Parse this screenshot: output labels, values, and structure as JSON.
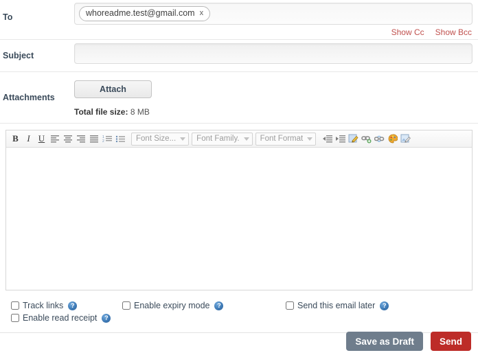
{
  "form": {
    "to": {
      "label": "To",
      "recipients": [
        {
          "address": "whoreadme.test@gmail.com",
          "remove_label": "x"
        }
      ],
      "show_cc": "Show Cc",
      "show_bcc": "Show Bcc"
    },
    "subject": {
      "label": "Subject",
      "value": "",
      "placeholder": ""
    },
    "attachments": {
      "label": "Attachments",
      "attach_button": "Attach",
      "total_size_label": "Total file size:",
      "total_size_value": "8 MB"
    }
  },
  "editor": {
    "toolbar": {
      "buttons": [
        {
          "name": "bold-icon",
          "glyph": "B"
        },
        {
          "name": "italic-icon",
          "glyph": "I"
        },
        {
          "name": "underline-icon",
          "glyph": "U"
        },
        {
          "name": "align-left-icon",
          "glyph": ""
        },
        {
          "name": "align-center-icon",
          "glyph": ""
        },
        {
          "name": "align-right-icon",
          "glyph": ""
        },
        {
          "name": "align-justify-icon",
          "glyph": ""
        },
        {
          "name": "ordered-list-icon",
          "glyph": ""
        },
        {
          "name": "unordered-list-icon",
          "glyph": ""
        },
        {
          "name": "outdent-icon",
          "glyph": ""
        },
        {
          "name": "indent-icon",
          "glyph": ""
        },
        {
          "name": "edit-source-icon",
          "glyph": ""
        },
        {
          "name": "insert-link-icon",
          "glyph": ""
        },
        {
          "name": "unlink-icon",
          "glyph": ""
        },
        {
          "name": "text-color-icon",
          "glyph": ""
        },
        {
          "name": "insert-image-icon",
          "glyph": ""
        }
      ],
      "selects": [
        {
          "name": "font-size-select",
          "label": "Font Size..."
        },
        {
          "name": "font-family-select",
          "label": "Font Family."
        },
        {
          "name": "font-format-select",
          "label": "Font Format"
        }
      ]
    },
    "body": ""
  },
  "options": [
    {
      "id": "track-links",
      "label": "Track links",
      "checked": false,
      "help": "?"
    },
    {
      "id": "enable-read-receipt",
      "label": "Enable read receipt",
      "checked": false,
      "help": "?"
    },
    {
      "id": "enable-expiry-mode",
      "label": "Enable expiry mode",
      "checked": false,
      "help": "?"
    },
    {
      "id": "send-this-email-later",
      "label": "Send this email later",
      "checked": false,
      "help": "?"
    }
  ],
  "footer": {
    "save_draft_label": "Save as Draft",
    "send_label": "Send"
  },
  "colors": {
    "link_red": "#c0504d",
    "send_red": "#bd2c28",
    "draft_gray": "#6f7d8c",
    "help_blue": "#3c78b4",
    "label_text": "#3a4a5a"
  }
}
